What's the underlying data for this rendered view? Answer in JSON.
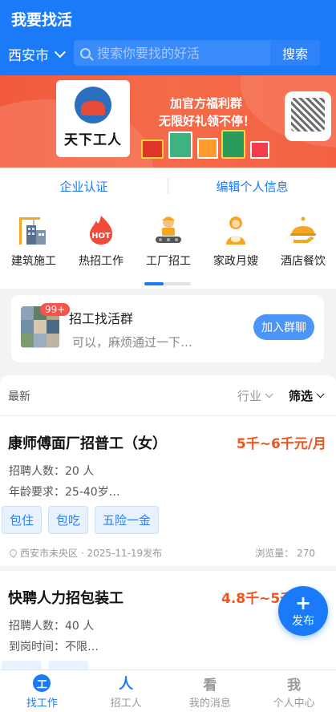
{
  "header": {
    "title": "我要找活",
    "city": "西安市",
    "search_placeholder": "搜索你要找的好活",
    "search_button": "搜索"
  },
  "banner": {
    "logo_text": "天下工人",
    "line1": "加官方福利群",
    "line2": "无限好礼领不停！"
  },
  "cert_row": {
    "left": "企业认证",
    "right": "编辑个人信息"
  },
  "categories": [
    {
      "label": "建筑施工",
      "icon": "building-icon"
    },
    {
      "label": "热招工作",
      "icon": "hot-fire-icon",
      "badge": "HOT"
    },
    {
      "label": "工厂招工",
      "icon": "factory-worker-icon"
    },
    {
      "label": "家政月嫂",
      "icon": "housekeeping-icon"
    },
    {
      "label": "酒店餐饮",
      "icon": "hotel-dining-icon"
    }
  ],
  "group": {
    "badge": "99+",
    "title": "招工找活群",
    "last_message": "可以，麻烦通过一下…",
    "join_button": "加入群聊"
  },
  "filters": {
    "latest": "最新",
    "industry": "行业",
    "filter": "筛选"
  },
  "jobs": [
    {
      "title": "康师傅面厂招普工（女）",
      "salary": "5千~6千元/月",
      "line1": "招聘人数：20 人",
      "line2": "年龄要求：25-40岁…",
      "tags": [
        "包住",
        "包吃",
        "五险一金"
      ],
      "location": "西安市未央区 · 2025-11-19发布",
      "views": "浏览量：  270"
    },
    {
      "title": "快聘人力招包装工",
      "salary": "4.8千~5千",
      "line1": "招聘人数：40 人",
      "line2": "到岗时间：不限…"
    }
  ],
  "fab": {
    "plus": "+",
    "label": "发布"
  },
  "tabbar": [
    {
      "label": "找工作",
      "icon": "find-work-icon",
      "glyph": "工",
      "active": true
    },
    {
      "label": "招工人",
      "icon": "recruit-icon",
      "glyph": "人"
    },
    {
      "label": "我的消息",
      "icon": "messages-icon",
      "glyph": "看"
    },
    {
      "label": "个人中心",
      "icon": "profile-icon",
      "glyph": "我"
    }
  ],
  "colors": {
    "primary": "#1a7af8",
    "salary": "#f0541e",
    "banner": "#f25a3c"
  }
}
